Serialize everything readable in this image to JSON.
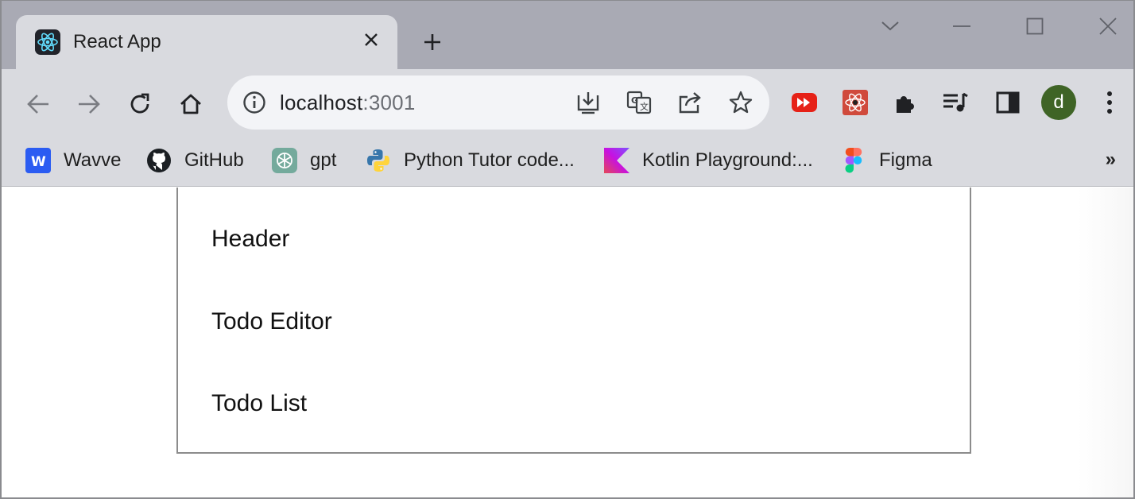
{
  "tab": {
    "title": "React App",
    "close_glyph": "✕"
  },
  "newtab": {
    "glyph": "+"
  },
  "window_controls": [
    "chevron-down",
    "minimize",
    "maximize",
    "close"
  ],
  "address_bar": {
    "host": "localhost",
    "port": ":3001"
  },
  "bookmarks": [
    {
      "label": "Wavve",
      "icon": "wavve-icon",
      "color": "#2b5cf2"
    },
    {
      "label": "GitHub",
      "icon": "github-icon",
      "color": "#1b1f23"
    },
    {
      "label": "gpt",
      "icon": "chatgpt-icon",
      "color": "#74aa9c"
    },
    {
      "label": "Python Tutor code...",
      "icon": "python-icon",
      "color": "#3776ab"
    },
    {
      "label": "Kotlin Playground:...",
      "icon": "kotlin-icon",
      "color": "#7f52ff"
    },
    {
      "label": "Figma",
      "icon": "figma-icon",
      "color": "#f24e1e"
    }
  ],
  "bookmarks_more": "»",
  "profile": {
    "initial": "d",
    "color": "#3f6426"
  },
  "app": {
    "sections": [
      "Header",
      "Todo Editor",
      "Todo List"
    ]
  }
}
